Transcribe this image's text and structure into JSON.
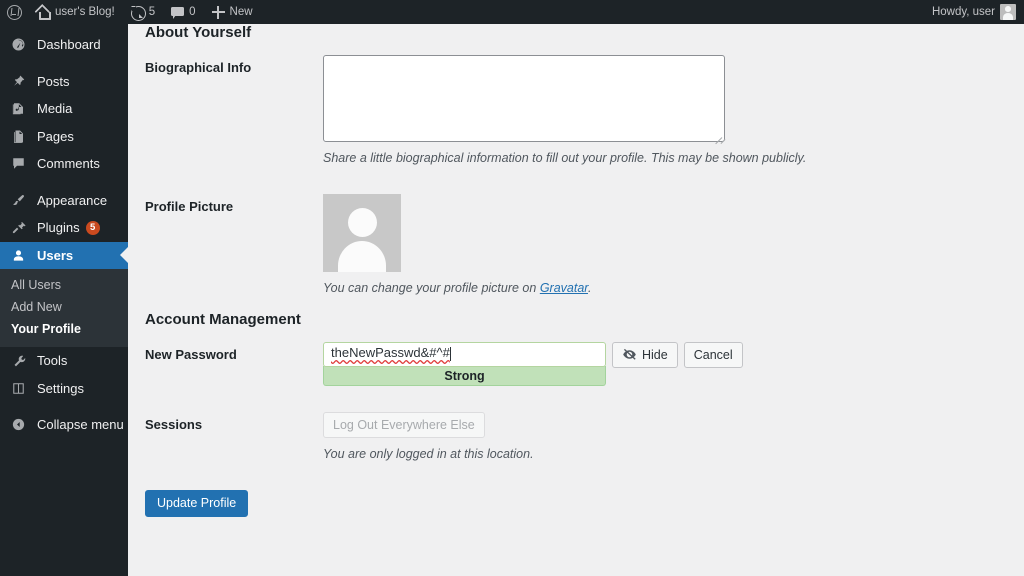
{
  "adminbar": {
    "logo_icon": "wordpress-logo-icon",
    "site": {
      "icon": "home-icon",
      "label": "user's Blog!"
    },
    "updates": {
      "icon": "update-icon",
      "count": "5"
    },
    "comments": {
      "icon": "comment-bubble-icon",
      "count": "0"
    },
    "new": {
      "icon": "plus-icon",
      "label": "New"
    },
    "account": {
      "label": "Howdy, user",
      "avatar_icon": "avatar-icon"
    }
  },
  "sidebar": {
    "items": [
      {
        "label": "Dashboard",
        "icon": "dashboard-icon",
        "name": "dashboard"
      },
      {
        "label": "Posts",
        "icon": "pin-icon",
        "name": "posts"
      },
      {
        "label": "Media",
        "icon": "media-icon",
        "name": "media"
      },
      {
        "label": "Pages",
        "icon": "pages-icon",
        "name": "pages"
      },
      {
        "label": "Comments",
        "icon": "comment-bubble-icon",
        "name": "comments"
      },
      {
        "label": "Appearance",
        "icon": "paintbrush-icon",
        "name": "appearance"
      },
      {
        "label": "Plugins",
        "icon": "plug-icon",
        "name": "plugins",
        "badge": "5"
      },
      {
        "label": "Users",
        "icon": "user-icon",
        "name": "users",
        "current": true
      },
      {
        "label": "Tools",
        "icon": "wrench-icon",
        "name": "tools"
      },
      {
        "label": "Settings",
        "icon": "settings-sliders-icon",
        "name": "settings"
      },
      {
        "label": "Collapse menu",
        "icon": "collapse-arrow-icon",
        "name": "collapse-menu"
      }
    ],
    "submenu": [
      {
        "label": "All Users",
        "name": "all-users",
        "current": false
      },
      {
        "label": "Add New",
        "name": "add-new",
        "current": false
      },
      {
        "label": "Your Profile",
        "name": "your-profile",
        "current": true
      }
    ]
  },
  "main": {
    "about_heading": "About Yourself",
    "bio": {
      "label": "Biographical Info",
      "value": "",
      "description": "Share a little biographical information to fill out your profile. This may be shown publicly."
    },
    "profile_picture": {
      "label": "Profile Picture",
      "description_before": "You can change your profile picture on ",
      "link_text": "Gravatar",
      "description_after": "."
    },
    "account_heading": "Account Management",
    "new_password": {
      "label": "New Password",
      "value": "theNewPasswd&#^#",
      "hide_button": "Hide",
      "hide_icon": "eye-slash-icon",
      "cancel_button": "Cancel",
      "strength": "Strong"
    },
    "sessions": {
      "label": "Sessions",
      "button": "Log Out Everywhere Else",
      "button_disabled": true,
      "description": "You are only logged in at this location."
    },
    "submit_button": "Update Profile"
  },
  "colors": {
    "admin_dark": "#1d2327",
    "submenu_dark": "#2c3338",
    "accent_blue": "#2271b1",
    "badge_orange": "#ca4a1f",
    "strength_green_bg": "#c1e1b9",
    "strength_green_border": "#a3d39c",
    "page_bg": "#f0f0f1"
  }
}
